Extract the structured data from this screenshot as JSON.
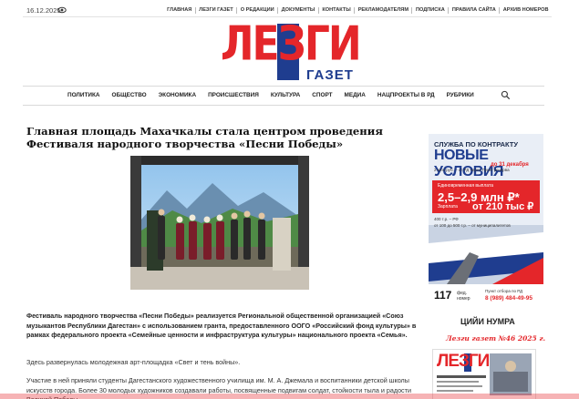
{
  "topbar": {
    "date": "16.12.2025",
    "links": [
      "ГЛАВНАЯ",
      "ЛЕЗГИ ГАЗЕТ",
      "О РЕДАКЦИИ",
      "ДОКУМЕНТЫ",
      "КОНТАКТЫ",
      "РЕКЛАМОДАТЕЛЯМ",
      "ПОДПИСКА",
      "ПРАВИЛА САЙТА",
      "АРХИВ НОМЕРОВ"
    ]
  },
  "logo": {
    "main": "ЛЕЗГИ",
    "sub": "ГАЗЕТ"
  },
  "nav": {
    "items": [
      "ПОЛИТИКА",
      "ОБЩЕСТВО",
      "ЭКОНОМИКА",
      "ПРОИСШЕСТВИЯ",
      "КУЛЬТУРА",
      "СПОРТ",
      "МЕДИА",
      "НАЦПРОЕКТЫ В РД",
      "РУБРИКИ"
    ]
  },
  "article": {
    "title": "Главная площадь Махачкалы стала центром проведения Фестиваля народного творчества «Песни Победы»",
    "lead": "Фестиваль народного творчества «Песни Победы» реализуется Региональной общественной организацией «Союз музыкантов Республики Дагестан» с использованием гранта, предоставленного ООГО «Российский фонд культуры» в рамках федерального проекта «Семейные ценности и инфраструктура культуры» национального проекта «Семья».",
    "p1": "Здесь развернулась молодежная арт-площадка «Свет и тень войны».",
    "p2": "Участие в ней приняли студенты Дагестанского художественного училища им. М. А. Джемала и воспитанники детской школы искусств города. Более 30 молодых художников создавали работы, посвященные подвигам солдат, стойкости тыла и радости Великой Победы."
  },
  "ad": {
    "h1": "СЛУЖБА ПО КОНТРАКТУ",
    "h2": "НОВЫЕ УСЛОВИЯ",
    "h3": "до 31 декабря",
    "s1": "2 млн руб. – от РД через Пункт резерва",
    "b1": "Единовременная выплата",
    "b2": "2,5–2,9 млн ₽*",
    "b3": "Зарплата",
    "b4": "от 210 тыс ₽",
    "s2": "400 т.р. – РФ",
    "s3": "от 100 до 500 т.р. – от муниципалитетов"
  },
  "phone": {
    "number": "117",
    "label_1": "фед.",
    "label_2": "номер",
    "t1": "Пункт отбора по РД",
    "t2": "8 (989) 484-49-95"
  },
  "issue": {
    "heading": "ЦИЙИ НУМРА",
    "subtitle": "Лезги газет №46 2025 г.",
    "thumb_logo": "ЛЕЗГИ"
  },
  "colors": {
    "brand_red": "#e4262a",
    "brand_blue": "#1f3d8f"
  },
  "icons": {
    "eye": "eye-icon",
    "search": "search-icon"
  }
}
